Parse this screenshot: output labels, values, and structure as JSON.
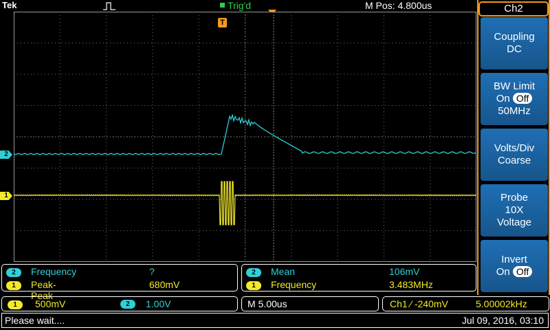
{
  "header": {
    "brand": "Tek",
    "trigger_status": "Trig'd",
    "m_pos": "M Pos: 4.800us"
  },
  "markers": {
    "ch1": "1",
    "ch2": "2",
    "trigger": "T"
  },
  "side_menu": {
    "title": "Ch2",
    "buttons": [
      {
        "line1": "Coupling",
        "line2": "DC"
      },
      {
        "line1": "BW Limit",
        "line2_prefix": "On",
        "line2_pill": "Off",
        "line3": "50MHz"
      },
      {
        "line1": "Volts/Div",
        "line2": "Coarse"
      },
      {
        "line1": "Probe",
        "line2": "10X",
        "line3": "Voltage"
      },
      {
        "line1": "Invert",
        "line2_prefix": "On",
        "line2_pill": "Off"
      }
    ]
  },
  "measurements": {
    "left": [
      {
        "channel": "2",
        "name": "Frequency",
        "value": "?"
      },
      {
        "channel": "1",
        "name": "Peak-Peak",
        "value": "680mV"
      }
    ],
    "right": [
      {
        "channel": "2",
        "name": "Mean",
        "value": "106mV"
      },
      {
        "channel": "1",
        "name": "Frequency",
        "value": "3.483MHz"
      }
    ]
  },
  "status": {
    "ch1_badge": "1",
    "ch1_scale": "500mV",
    "ch2_badge": "2",
    "ch2_scale": "1.00V",
    "timebase": "M 5.00us",
    "trigger_source": "Ch1",
    "trigger_slope": "⁄",
    "trigger_level": "-240mV",
    "trigger_freq": "5.00002kHz"
  },
  "footer": {
    "message": "Please wait....",
    "datetime": "Jul 09, 2016, 03:10"
  },
  "colors": {
    "ch1": "#f2ea2a",
    "ch2": "#2fd0d6",
    "trigger": "#f39a1d",
    "menu_button": "#1f6fb5",
    "trig_status": "#27d14b"
  }
}
